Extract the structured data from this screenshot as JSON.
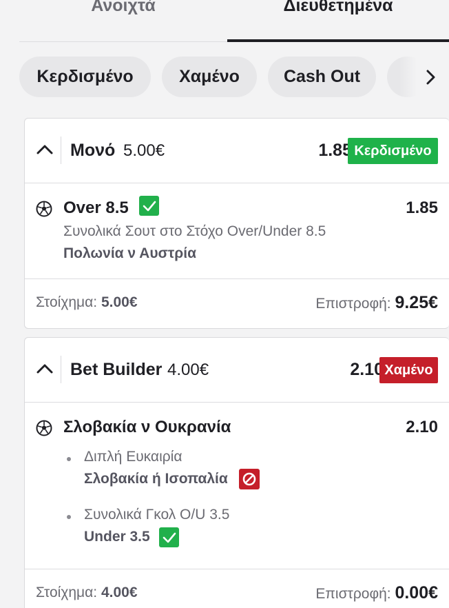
{
  "tabs": {
    "open": "Ανοιχτά",
    "settled": "Διευθετημένα"
  },
  "filters": {
    "won": "Κερδισμένο",
    "lost": "Χαμένο",
    "cashout": "Cash Out"
  },
  "bet1": {
    "type": "Μονό",
    "stake": "5.00€",
    "odds": "1.85",
    "status": "Κερδισμένο",
    "selection": {
      "name": "Over 8.5",
      "odds": "1.85",
      "market": "Συνολικά Σουτ στο Στόχο Over/Under 8.5",
      "event": "Πολωνία ν Αυστρία"
    },
    "footer": {
      "stake_label": "Στοίχημα:",
      "stake_value": "5.00€",
      "return_label": "Επιστροφή:",
      "return_value": "9.25€"
    }
  },
  "bet2": {
    "type": "Bet Builder",
    "stake": "4.00€",
    "odds": "2.10",
    "status": "Χαμένο",
    "event": "Σλοβακία ν Ουκρανία",
    "event_odds": "2.10",
    "legs": [
      {
        "market": "Διπλή Ευκαιρία",
        "selection": "Σλοβακία ή Ισοπαλία",
        "result": "lost"
      },
      {
        "market": "Συνολικά Γκολ O/U 3.5",
        "selection": "Under 3.5",
        "result": "won"
      }
    ],
    "footer": {
      "stake_label": "Στοίχημα:",
      "stake_value": "4.00€",
      "return_label": "Επιστροφή:",
      "return_value": "0.00€"
    }
  },
  "colors": {
    "won": "#1fb24a",
    "lost": "#c51f2a",
    "text": "#1f1f24",
    "muted": "#6b6b72"
  }
}
